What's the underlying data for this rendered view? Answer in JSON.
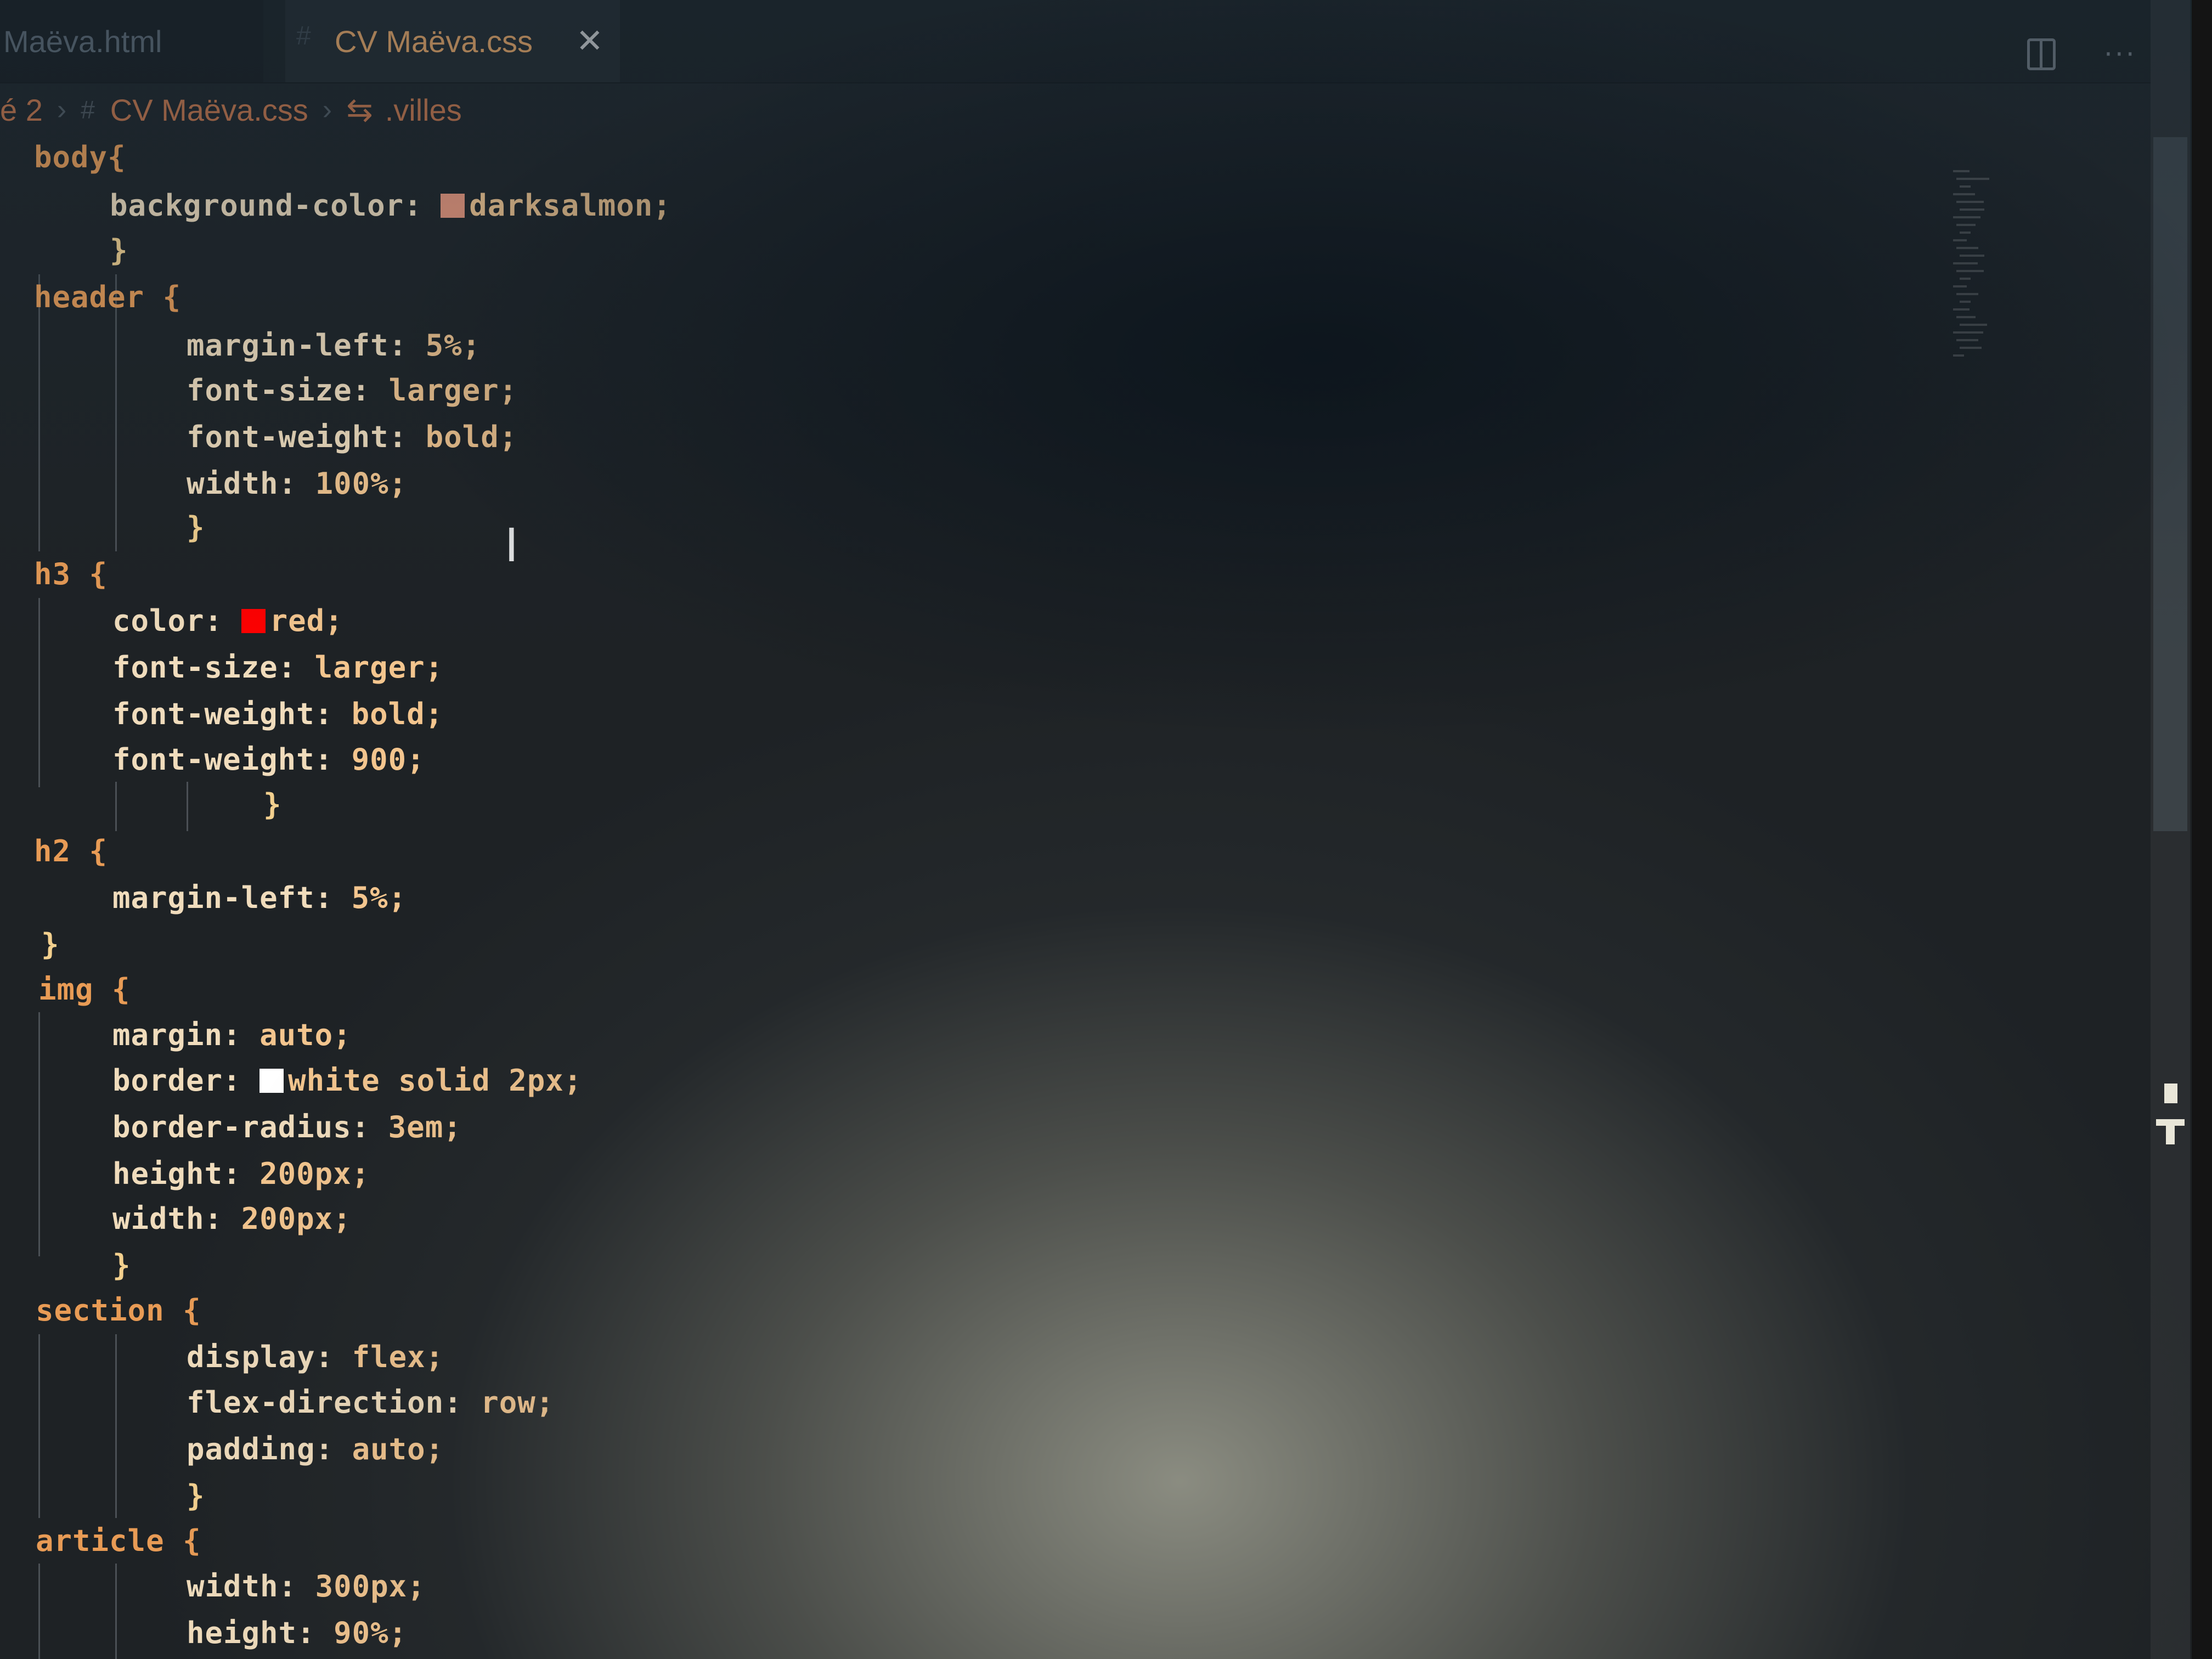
{
  "tabs": [
    {
      "label": "Maëva.html",
      "active": false
    },
    {
      "label": "CV Maëva.css",
      "active": true,
      "icon": "css-hash-icon"
    }
  ],
  "breadcrumb": {
    "items": [
      "é 2",
      "CV Maëva.css",
      ".villes"
    ],
    "symbol_icon": "css-selector-icon"
  },
  "editor_actions": {
    "split_icon": "split-editor-icon",
    "more_label": "···"
  },
  "colors": {
    "selector": "#e89b55",
    "property": "#f0dcbc",
    "value": "#f3c58e",
    "darksalmon": "#e9967a",
    "red": "#ff0000",
    "white": "#ffffff"
  },
  "code": [
    {
      "sel": "body{"
    },
    {
      "prop": "background-color:",
      "swatch": "#e9967a",
      "val": "darksalmon;"
    },
    {
      "brace": "}"
    },
    {
      "sel": "header {"
    },
    {
      "prop": "margin-left:",
      "val": "5%;"
    },
    {
      "prop": "font-size:",
      "val": "larger;"
    },
    {
      "prop": "font-weight:",
      "val": "bold;"
    },
    {
      "prop": "width:",
      "val": "100%;"
    },
    {
      "brace": "}"
    },
    {
      "sel": "h3 {"
    },
    {
      "prop": "color:",
      "swatch": "#ff0000",
      "val": "red;"
    },
    {
      "prop": "font-size:",
      "val": "larger;"
    },
    {
      "prop": "font-weight:",
      "val": "bold;"
    },
    {
      "prop": "font-weight:",
      "val": "900;"
    },
    {
      "brace": "}"
    },
    {
      "sel": "h2 {"
    },
    {
      "prop": "margin-left:",
      "val": "5%;"
    },
    {
      "brace": "}"
    },
    {
      "sel": "img {"
    },
    {
      "prop": "margin:",
      "val": "auto;"
    },
    {
      "prop": "border:",
      "swatch": "#ffffff",
      "val": "white solid 2px;"
    },
    {
      "prop": "border-radius:",
      "val": "3em;"
    },
    {
      "prop": "height:",
      "val": "200px;"
    },
    {
      "prop": "width:",
      "val": "200px;"
    },
    {
      "brace": "}"
    },
    {
      "sel": "section {"
    },
    {
      "prop": "display:",
      "val": "flex;"
    },
    {
      "prop": "flex-direction:",
      "val": "row;"
    },
    {
      "prop": "padding:",
      "val": "auto;"
    },
    {
      "brace": "}"
    },
    {
      "sel": "article {"
    },
    {
      "prop": "width:",
      "val": "300px;"
    },
    {
      "prop": "height:",
      "val": "90%;"
    }
  ]
}
